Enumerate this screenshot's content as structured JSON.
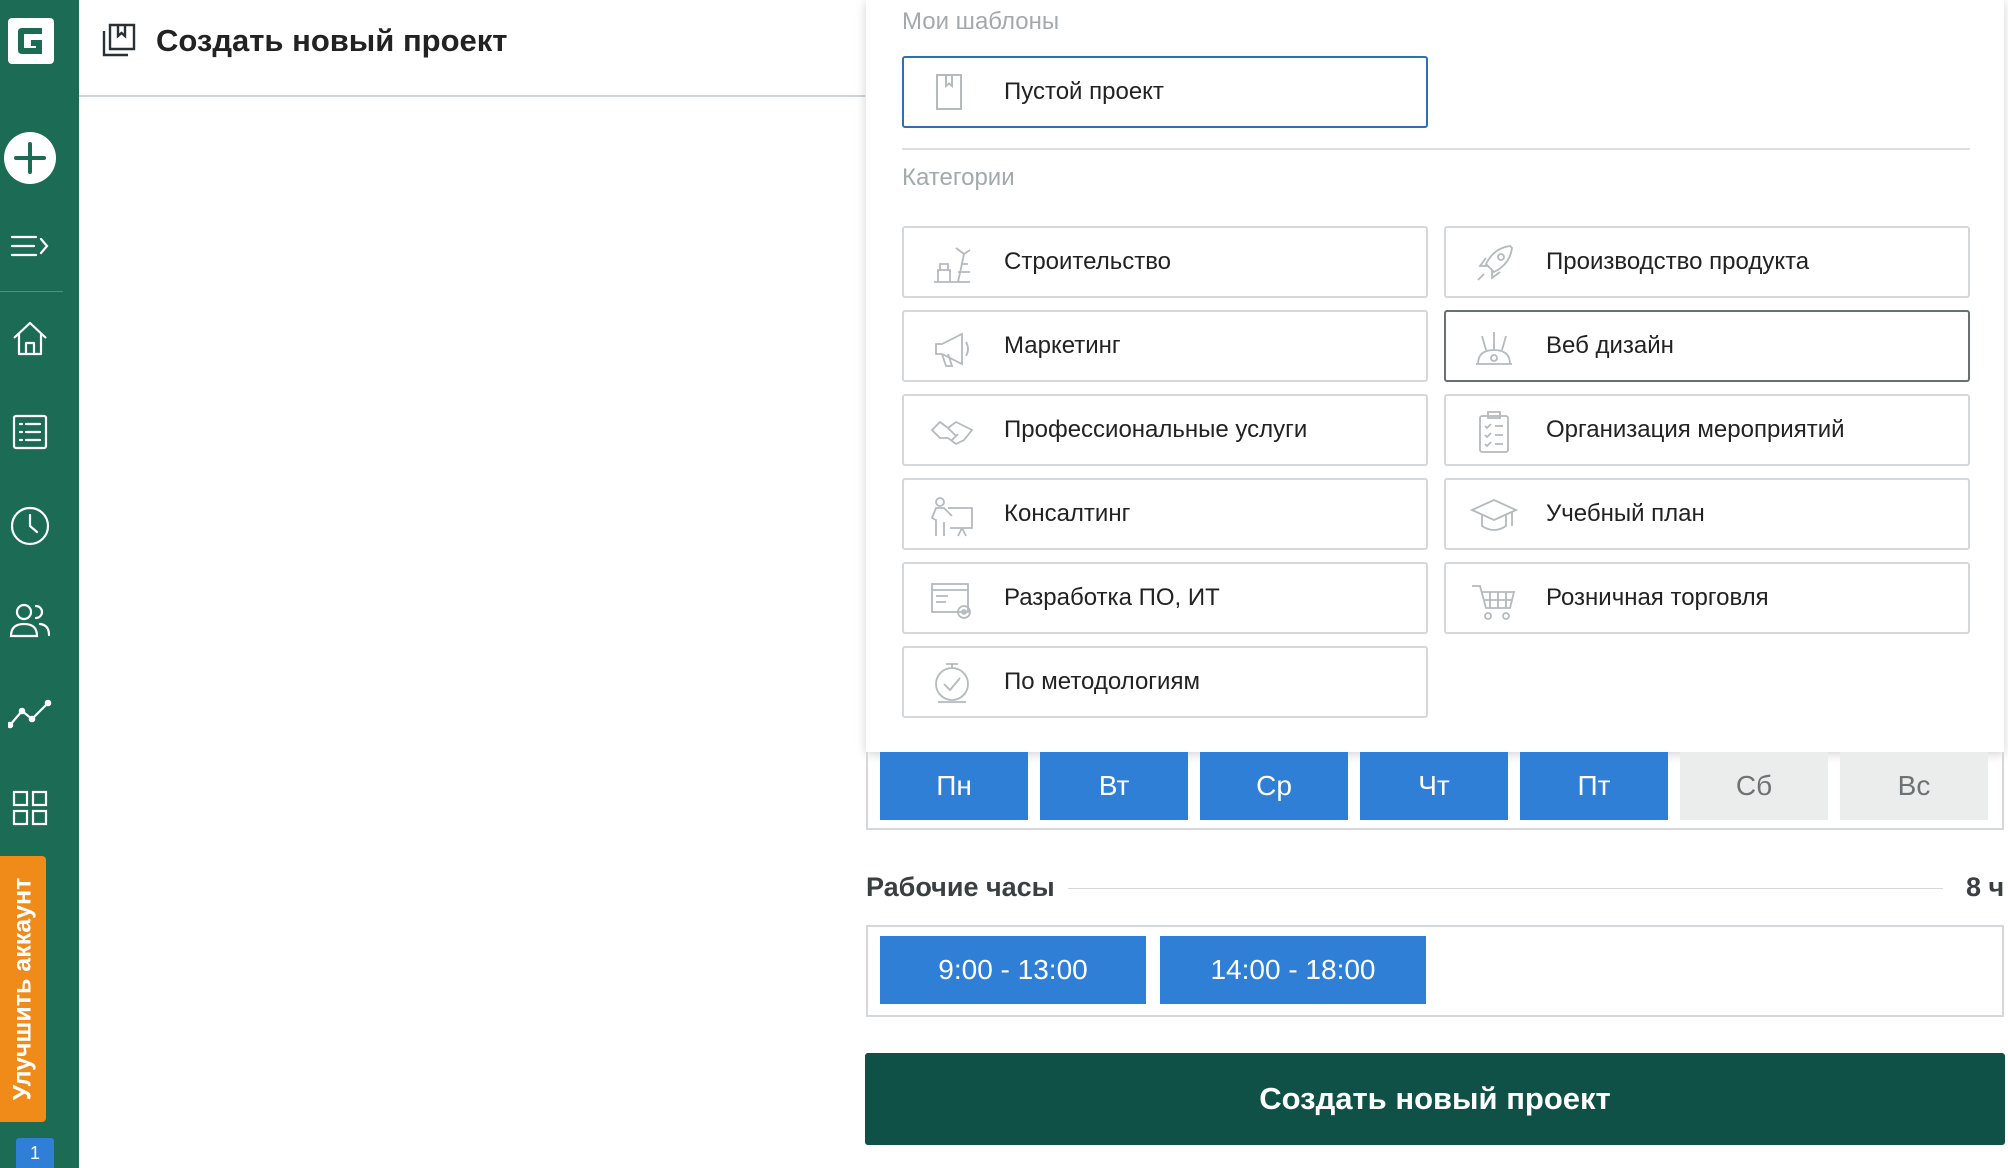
{
  "header": {
    "title": "Создать новый проект"
  },
  "sidebar": {
    "upgrade_label": "Улучшить аккаунт",
    "badge_count": "1"
  },
  "templates": {
    "my_templates_label": "Мои шаблоны",
    "blank_project_label": "Пустой проект",
    "categories_label": "Категории",
    "categories": [
      {
        "label": "Строительство",
        "icon": "construction-icon"
      },
      {
        "label": "Производство продукта",
        "icon": "rocket-icon"
      },
      {
        "label": "Маркетинг",
        "icon": "megaphone-icon"
      },
      {
        "label": "Веб дизайн",
        "icon": "web-design-icon"
      },
      {
        "label": "Профессиональные услуги",
        "icon": "handshake-icon"
      },
      {
        "label": "Организация мероприятий",
        "icon": "checklist-icon"
      },
      {
        "label": "Консалтинг",
        "icon": "presentation-icon"
      },
      {
        "label": "Учебный план",
        "icon": "graduation-cap-icon"
      },
      {
        "label": "Разработка ПО, ИТ",
        "icon": "browser-gear-icon"
      },
      {
        "label": "Розничная торговля",
        "icon": "shopping-cart-icon"
      },
      {
        "label": "По методологиям",
        "icon": "methodology-clock-icon"
      }
    ]
  },
  "days": [
    {
      "label": "Пн",
      "active": true
    },
    {
      "label": "Вт",
      "active": true
    },
    {
      "label": "Ср",
      "active": true
    },
    {
      "label": "Чт",
      "active": true
    },
    {
      "label": "Пт",
      "active": true
    },
    {
      "label": "Сб",
      "active": false
    },
    {
      "label": "Вс",
      "active": false
    }
  ],
  "working_hours": {
    "label": "Рабочие часы",
    "total": "8 ч",
    "slots": [
      "9:00 - 13:00",
      "14:00 - 18:00"
    ]
  },
  "create_button_label": "Создать новый проект",
  "colors": {
    "sidebar": "#1b6b55",
    "primary_blue": "#2f7fd6",
    "create_button": "#0f5146",
    "upgrade": "#f08b1a"
  }
}
